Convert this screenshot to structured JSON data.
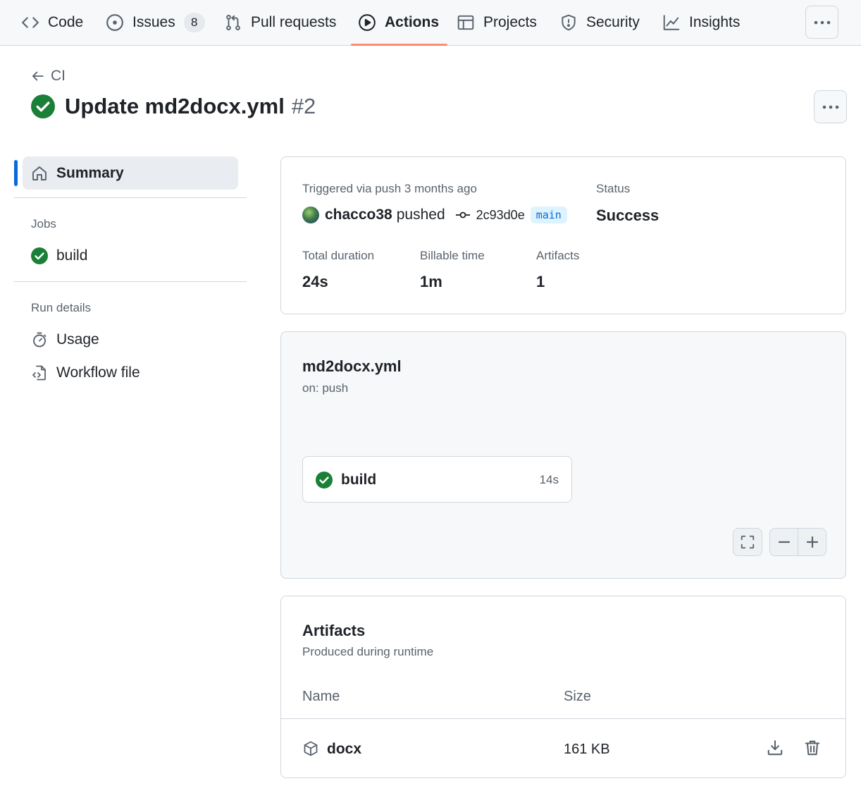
{
  "nav": {
    "tabs": [
      {
        "label": "Code",
        "icon": "code-icon"
      },
      {
        "label": "Issues",
        "icon": "issue-opened-icon",
        "count": "8"
      },
      {
        "label": "Pull requests",
        "icon": "git-pull-request-icon"
      },
      {
        "label": "Actions",
        "icon": "play-icon",
        "active": true
      },
      {
        "label": "Projects",
        "icon": "table-icon"
      },
      {
        "label": "Security",
        "icon": "shield-icon"
      },
      {
        "label": "Insights",
        "icon": "graph-icon"
      }
    ],
    "accent_color": "#fd8c73"
  },
  "header": {
    "back_label": "CI",
    "title": "Update md2docx.yml",
    "run_number": "#2",
    "status_color": "#1a7f37"
  },
  "sidebar": {
    "summary_label": "Summary",
    "jobs_heading": "Jobs",
    "jobs": [
      {
        "label": "build",
        "status": "success"
      }
    ],
    "run_details_heading": "Run details",
    "run_details": [
      {
        "label": "Usage",
        "icon": "stopwatch-icon"
      },
      {
        "label": "Workflow file",
        "icon": "file-code-icon"
      }
    ]
  },
  "summary": {
    "trigger_label": "Triggered via push 3 months ago",
    "actor": "chacco38",
    "action": "pushed",
    "commit": "2c93d0e",
    "branch": "main",
    "status_label": "Status",
    "status_value": "Success",
    "duration_label": "Total duration",
    "duration_value": "24s",
    "billable_label": "Billable time",
    "billable_value": "1m",
    "artifacts_label": "Artifacts",
    "artifacts_value": "1"
  },
  "workflow": {
    "name": "md2docx.yml",
    "trigger": "on: push",
    "job": {
      "name": "build",
      "duration": "14s"
    }
  },
  "artifacts": {
    "title": "Artifacts",
    "subtitle": "Produced during runtime",
    "col_name": "Name",
    "col_size": "Size",
    "rows": [
      {
        "name": "docx",
        "size": "161 KB"
      }
    ]
  }
}
